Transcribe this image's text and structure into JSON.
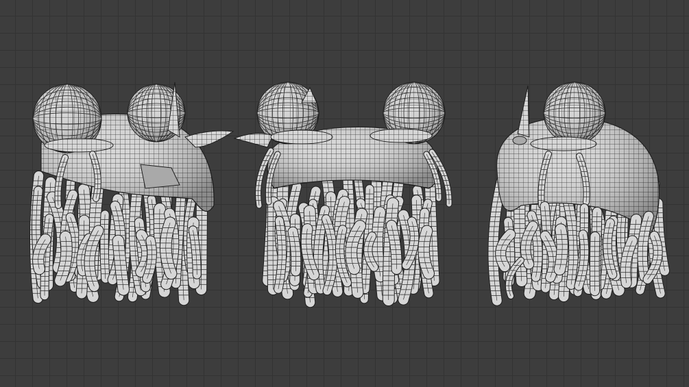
{
  "viewport": {
    "background": "#3d3d3d",
    "grid_color": "#333333"
  },
  "mesh": {
    "fill": "#d6d6d6",
    "shade": "#a9a9a9",
    "wire": "#1e1e1e",
    "views": [
      "left-three-quarter",
      "front",
      "right-three-quarter"
    ]
  }
}
